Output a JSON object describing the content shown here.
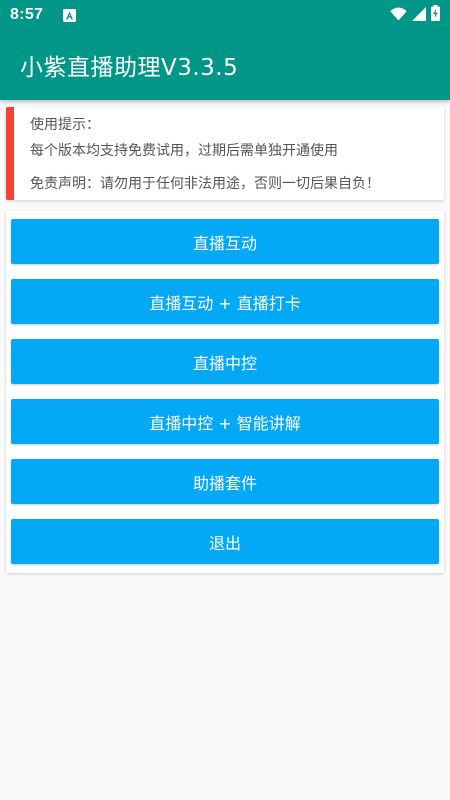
{
  "status_bar": {
    "time": "8:57",
    "icons": [
      "android-app-icon",
      "wifi-icon",
      "cellular-signal-icon",
      "battery-charging-icon"
    ]
  },
  "app_bar": {
    "title": "小紫直播助理V3.3.5",
    "color": "#009688"
  },
  "notice": {
    "heading": "使用提示：",
    "trial_text": "每个版本均支持免费试用，过期后需单独开通使用",
    "disclaimer": "免责声明：请勿用于任何非法用途，否则一切后果自负！",
    "accent_color": "#f44336"
  },
  "menu": {
    "button_color": "#03a9f4",
    "buttons": [
      {
        "label": "直播互动"
      },
      {
        "label": "直播互动 + 直播打卡"
      },
      {
        "label": "直播中控"
      },
      {
        "label": "直播中控 + 智能讲解"
      },
      {
        "label": "助播套件"
      },
      {
        "label": "退出"
      }
    ]
  }
}
